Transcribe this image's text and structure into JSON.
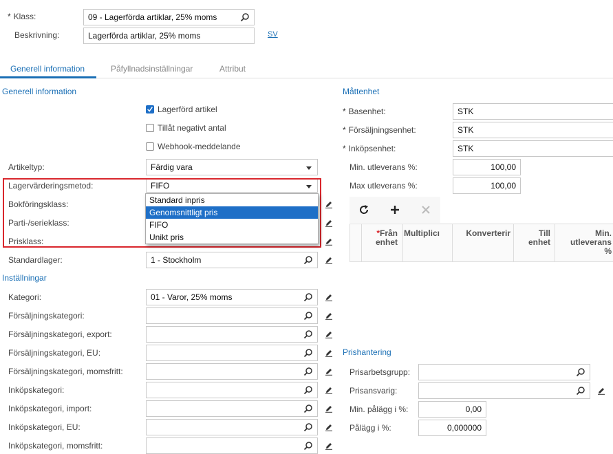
{
  "header": {
    "class_label": "Klass:",
    "class_value": "09 - Lagerförda artiklar, 25% moms",
    "desc_label": "Beskrivning:",
    "desc_value": "Lagerförda artiklar, 25% moms",
    "lang_link": "SV"
  },
  "tabs": [
    {
      "label": "Generell information"
    },
    {
      "label": "Påfyllnadsinställningar"
    },
    {
      "label": "Attribut"
    }
  ],
  "general": {
    "title": "Generell information",
    "checkboxes": [
      {
        "label": "Lagerförd artikel",
        "checked": true
      },
      {
        "label": "Tillåt negativt antal",
        "checked": false
      },
      {
        "label": "Webhook-meddelande",
        "checked": false
      }
    ],
    "item_type_label": "Artikeltyp:",
    "item_type_value": "Färdig vara",
    "valuation_label": "Lagervärderingsmetod:",
    "valuation_value": "FIFO",
    "posting_class_label": "Bokföringsklass:",
    "lot_class_label": "Parti-/serieklass:",
    "price_class_label": "Prisklass:",
    "default_wh_label": "Standardlager:",
    "default_wh_value": "1 - Stockholm",
    "dropdown_options": [
      "Standard inpris",
      "Genomsnittligt pris",
      "FIFO",
      "Unikt pris"
    ],
    "dropdown_selected_index": 1
  },
  "settings": {
    "title": "Inställningar",
    "category_label": "Kategori:",
    "category_value": "01 - Varor, 25% moms",
    "fields": [
      {
        "label": "Försäljningskategori:",
        "value": ""
      },
      {
        "label": "Försäljningskategori, export:",
        "value": ""
      },
      {
        "label": "Försäljningskategori, EU:",
        "value": ""
      },
      {
        "label": "Försäljningskategori, momsfritt:",
        "value": ""
      },
      {
        "label": "Inköpskategori:",
        "value": ""
      },
      {
        "label": "Inköpskategori, import:",
        "value": ""
      },
      {
        "label": "Inköpskategori, EU:",
        "value": ""
      },
      {
        "label": "Inköpskategori, momsfritt:",
        "value": ""
      }
    ]
  },
  "uom": {
    "title": "Måttenhet",
    "base_label": "Basenhet:",
    "base_value": "STK",
    "sales_label": "Försäljningsenhet:",
    "sales_value": "STK",
    "purchase_label": "Inköpsenhet:",
    "purchase_value": "STK",
    "min_label": "Min. utleverans %:",
    "min_value": "100,00",
    "max_label": "Max utleverans %:",
    "max_value": "100,00",
    "grid_headers": {
      "from_unit_star": "*",
      "from_unit_1": "Från",
      "from_unit_2": "enhet",
      "multiplier": "Multiplicı",
      "conversion": "Konverterir",
      "to_unit_1": "Till",
      "to_unit_2": "enhet",
      "min_1": "Min.",
      "min_2": "utleverans",
      "min_3": "%"
    }
  },
  "pricing": {
    "title": "Prishantering",
    "workgroup_label": "Prisarbetsgrupp:",
    "workgroup_value": "",
    "manager_label": "Prisansvarig:",
    "manager_value": "",
    "min_markup_label": "Min. pålägg i %:",
    "min_markup_value": "0,00",
    "markup_label": "Pålägg i %:",
    "markup_value": "0,000000"
  },
  "colors": {
    "accent": "#1a6fb5",
    "highlight_box": "#d9262c",
    "selection": "#1e6fc7"
  }
}
